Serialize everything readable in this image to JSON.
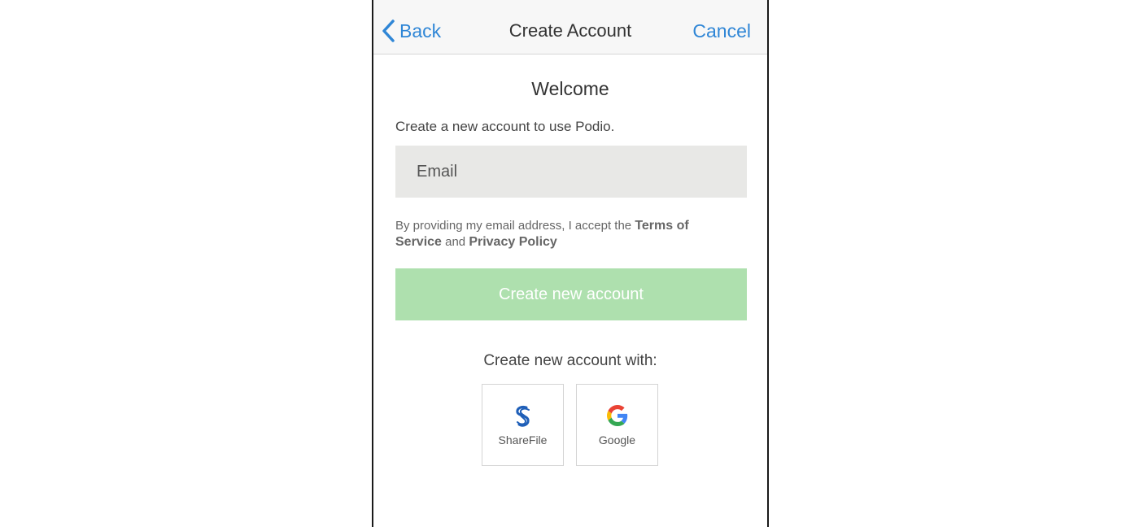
{
  "navbar": {
    "back_label": "Back",
    "title": "Create Account",
    "cancel_label": "Cancel"
  },
  "main": {
    "welcome": "Welcome",
    "intro": "Create a new account to use Podio.",
    "email": {
      "placeholder": "Email",
      "value": ""
    },
    "terms": {
      "prefix": "By providing my email address, I accept the",
      "terms_link": "Terms of Service",
      "conjunction": "and",
      "privacy_link": "Privacy Policy"
    },
    "create_button_label": "Create new account",
    "alt_signup_label": "Create new account with:",
    "providers": [
      {
        "label": "ShareFile",
        "icon": "sharefile-icon"
      },
      {
        "label": "Google",
        "icon": "google-icon"
      }
    ]
  },
  "colors": {
    "link_blue": "#2f86d6",
    "create_button_bg": "#aee0ae",
    "input_bg": "#e8e8e6",
    "sharefile_blue": "#1f5fb8"
  }
}
